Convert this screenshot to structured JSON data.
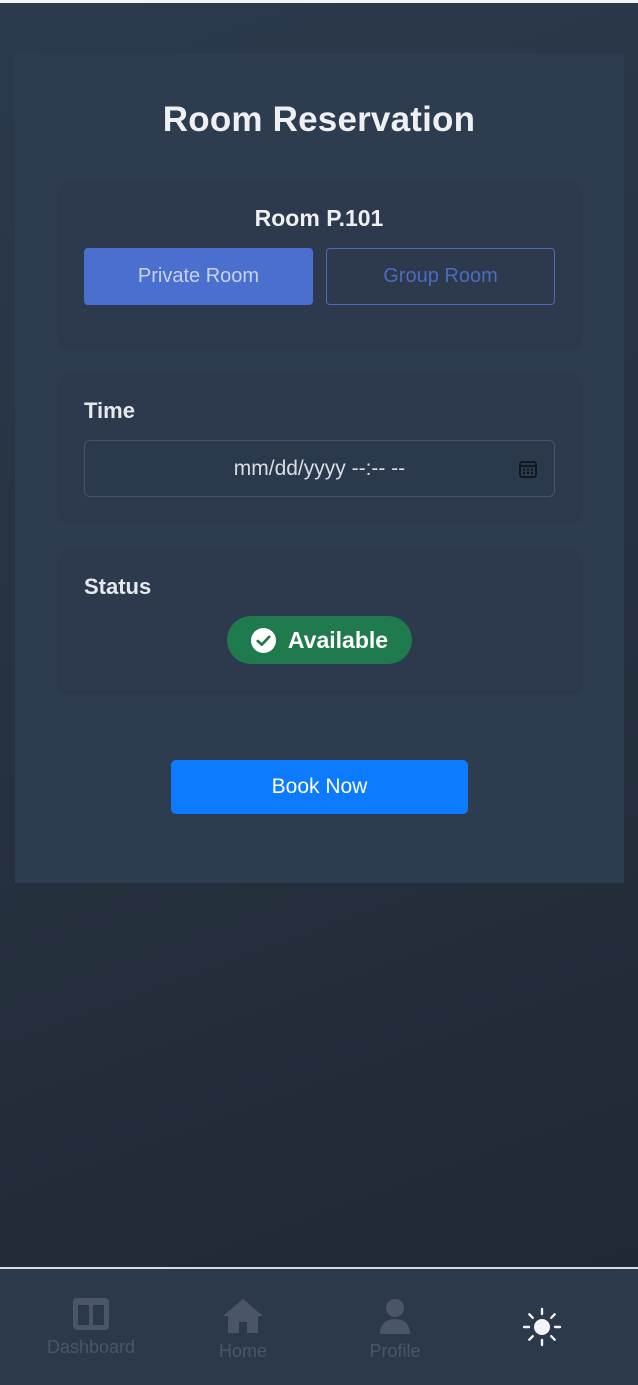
{
  "page": {
    "title": "Room Reservation"
  },
  "room": {
    "name": "Room P.101",
    "types": [
      "Private Room",
      "Group Room"
    ],
    "selected_type": "Private Room"
  },
  "time": {
    "label": "Time",
    "value": "mm/dd/yyyy --:--  --",
    "icon": "calendar-icon"
  },
  "status": {
    "label": "Status",
    "value": "Available",
    "icon": "check-circle-icon",
    "color": "#1f7a4d"
  },
  "actions": {
    "book_label": "Book Now",
    "book_color": "#0d7bff"
  },
  "nav": {
    "items": [
      {
        "label": "Dashboard",
        "icon": "dashboard-icon"
      },
      {
        "label": "Home",
        "icon": "home-icon"
      },
      {
        "label": "Profile",
        "icon": "profile-icon"
      }
    ],
    "theme_toggle_icon": "sun-icon"
  },
  "colors": {
    "accent": "#4a6fcf",
    "background": "#26313f",
    "card": "#2e3c50"
  }
}
